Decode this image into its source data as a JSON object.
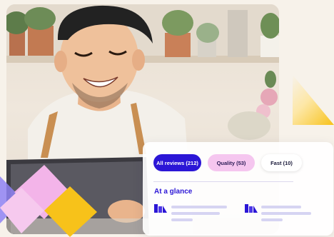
{
  "filters": {
    "all_label": "All reviews (212)",
    "quality_label": "Quality (53)",
    "fast_label": "Fast (10)"
  },
  "summary": {
    "heading": "At a glance"
  },
  "icons": {
    "stat_left": "bar-chart-icon",
    "stat_right": "bar-chart-icon"
  },
  "colors": {
    "accent": "#2b16d6",
    "quality_chip": "#f5c6ef",
    "yellow": "#f7c21a",
    "pink": "#f3b4e9",
    "background": "#f7f2ea"
  }
}
